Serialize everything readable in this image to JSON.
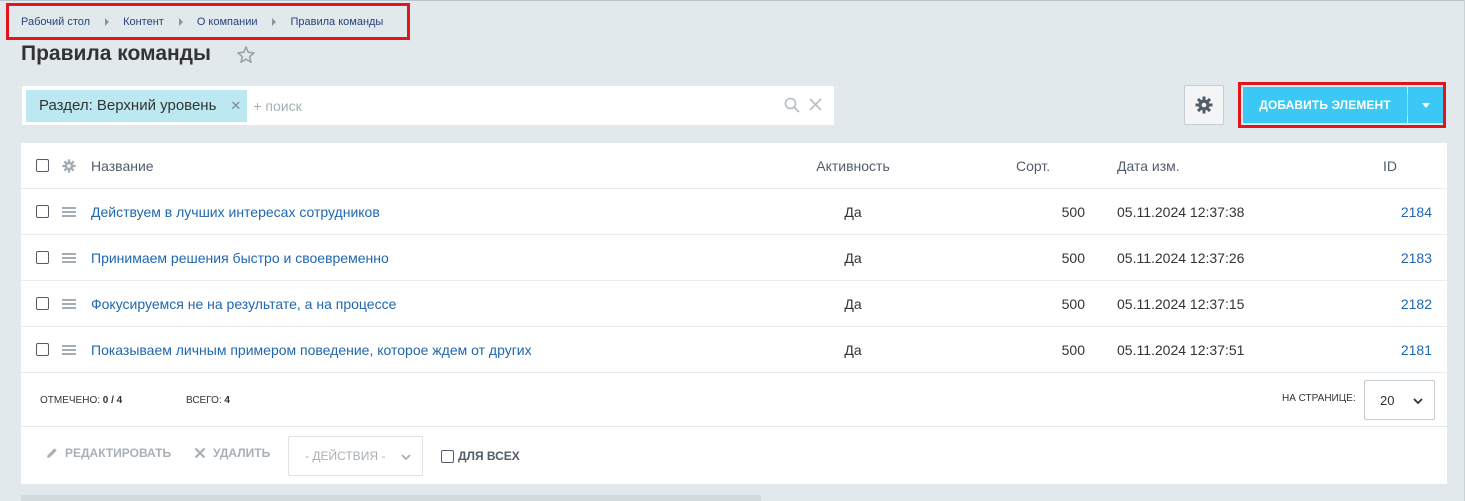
{
  "breadcrumb": [
    "Рабочий стол",
    "Контент",
    "О компании",
    "Правила команды"
  ],
  "page_title": "Правила команды",
  "filter": {
    "tag": "Раздел: Верхний уровень",
    "search_placeholder": "+ поиск"
  },
  "toolbar": {
    "add_label": "ДОБАВИТЬ ЭЛЕМЕНТ"
  },
  "columns": {
    "name": "Название",
    "active": "Активность",
    "sort": "Сорт.",
    "date": "Дата изм.",
    "id": "ID"
  },
  "rows": [
    {
      "name": "Действуем в лучших интересах сотрудников",
      "active": "Да",
      "sort": "500",
      "date": "05.11.2024 12:37:38",
      "id": "2184"
    },
    {
      "name": "Принимаем решения быстро и своевременно",
      "active": "Да",
      "sort": "500",
      "date": "05.11.2024 12:37:26",
      "id": "2183"
    },
    {
      "name": "Фокусируемся не на результате, а на процессе",
      "active": "Да",
      "sort": "500",
      "date": "05.11.2024 12:37:15",
      "id": "2182"
    },
    {
      "name": "Показываем личным примером поведение, которое ждем от других",
      "active": "Да",
      "sort": "500",
      "date": "05.11.2024 12:37:51",
      "id": "2181"
    }
  ],
  "footer": {
    "selected_label": "ОТМЕЧЕНО:",
    "selected_value": "0 / 4",
    "total_label": "ВСЕГО:",
    "total_value": "4",
    "per_page_label": "НА СТРАНИЦЕ:",
    "per_page_value": "20"
  },
  "actions": {
    "edit": "РЕДАКТИРОВАТЬ",
    "delete": "УДАЛИТЬ",
    "actions_select": "- ДЕЙСТВИЯ -",
    "for_all": "ДЛЯ ВСЕХ"
  },
  "colors": {
    "accent": "#3bc8f5",
    "link": "#2067b0",
    "highlight": "#e0161c",
    "filter_tag": "#bce8f1"
  }
}
